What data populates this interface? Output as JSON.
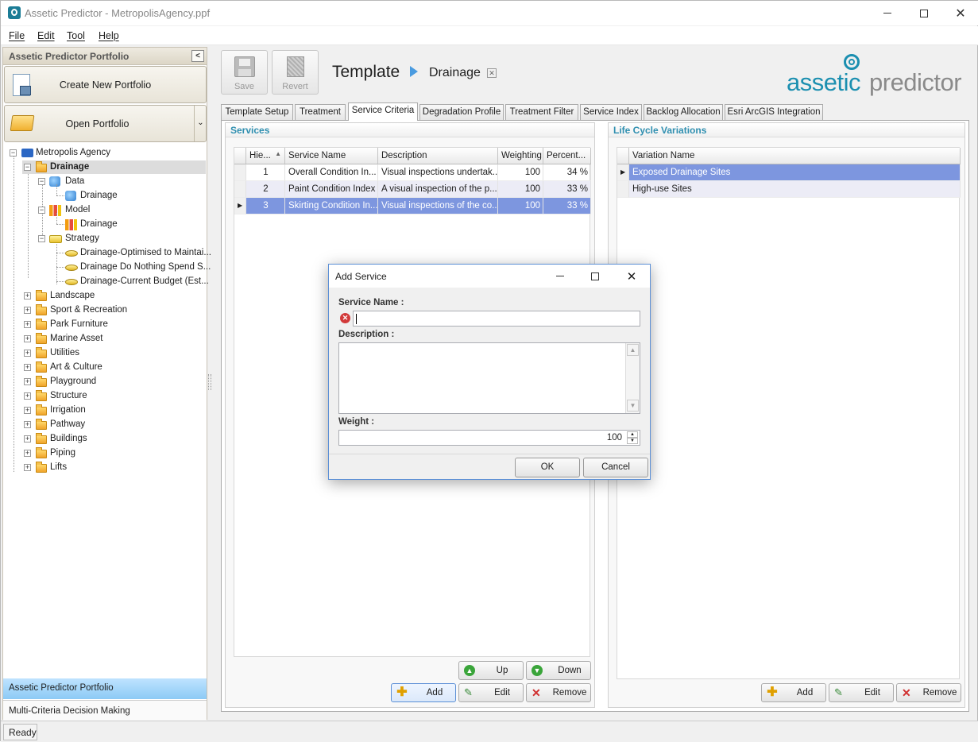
{
  "window": {
    "title": "Assetic Predictor - MetropolisAgency.ppf"
  },
  "menu": [
    "File",
    "Edit",
    "Tool",
    "Help"
  ],
  "left_panel": {
    "header": "Assetic Predictor Portfolio",
    "create_button": "Create New Portfolio",
    "open_button": "Open Portfolio",
    "tree": {
      "root": "Metropolis Agency",
      "drainage": "Drainage",
      "data": "Data",
      "data_child": "Drainage",
      "model": "Model",
      "model_child": "Drainage",
      "strategy": "Strategy",
      "strategies": [
        "Drainage-Optimised to Maintai...",
        "Drainage Do Nothing Spend S...",
        "Drainage-Current Budget (Est..."
      ],
      "categories": [
        "Landscape",
        "Sport & Recreation",
        "Park Furniture",
        "Marine Asset",
        "Utilities",
        "Art & Culture",
        "Playground",
        "Structure",
        "Irrigation",
        "Pathway",
        "Buildings",
        "Piping",
        "Lifts"
      ]
    },
    "nav_portfolio": "Assetic Predictor Portfolio",
    "nav_mcdm": "Multi-Criteria Decision Making"
  },
  "toolbar": {
    "save": "Save",
    "revert": "Revert",
    "breadcrumb_root": "Template",
    "breadcrumb_current": "Drainage"
  },
  "logo": {
    "part1": "assetic",
    "part2": "predictor"
  },
  "tabs": [
    "Template Setup",
    "Treatment",
    "Service Criteria",
    "Degradation Profile",
    "Treatment Filter",
    "Service Index",
    "Backlog Allocation",
    "Esri ArcGIS Integration"
  ],
  "services": {
    "title": "Services",
    "columns": [
      "Hie...",
      "Service Name",
      "Description",
      "Weighting",
      "Percent..."
    ],
    "rows": [
      [
        "1",
        "Overall Condition In...",
        "Visual inspections undertak...",
        "100",
        "34 %"
      ],
      [
        "2",
        "Paint Condition Index",
        "A visual inspection of the p...",
        "100",
        "33 %"
      ],
      [
        "3",
        "Skirting Condition In...",
        "Visual inspections of the co...",
        "100",
        "33 %"
      ]
    ],
    "up": "Up",
    "down": "Down",
    "add": "Add",
    "edit": "Edit",
    "remove": "Remove"
  },
  "lifecycle": {
    "title": "Life Cycle Variations",
    "column": "Variation Name",
    "rows": [
      "Exposed Drainage Sites",
      "High-use Sites"
    ],
    "add": "Add",
    "edit": "Edit",
    "remove": "Remove"
  },
  "dialog": {
    "title": "Add Service",
    "service_name_label": "Service Name :",
    "service_name_value": "",
    "description_label": "Description :",
    "description_value": "",
    "weight_label": "Weight :",
    "weight_value": "100",
    "ok": "OK",
    "cancel": "Cancel"
  },
  "status": "Ready",
  "colors": {
    "accent_blue": "#2f8fb0",
    "selection": "#7d96df",
    "logo_teal": "#1b8fb0"
  }
}
